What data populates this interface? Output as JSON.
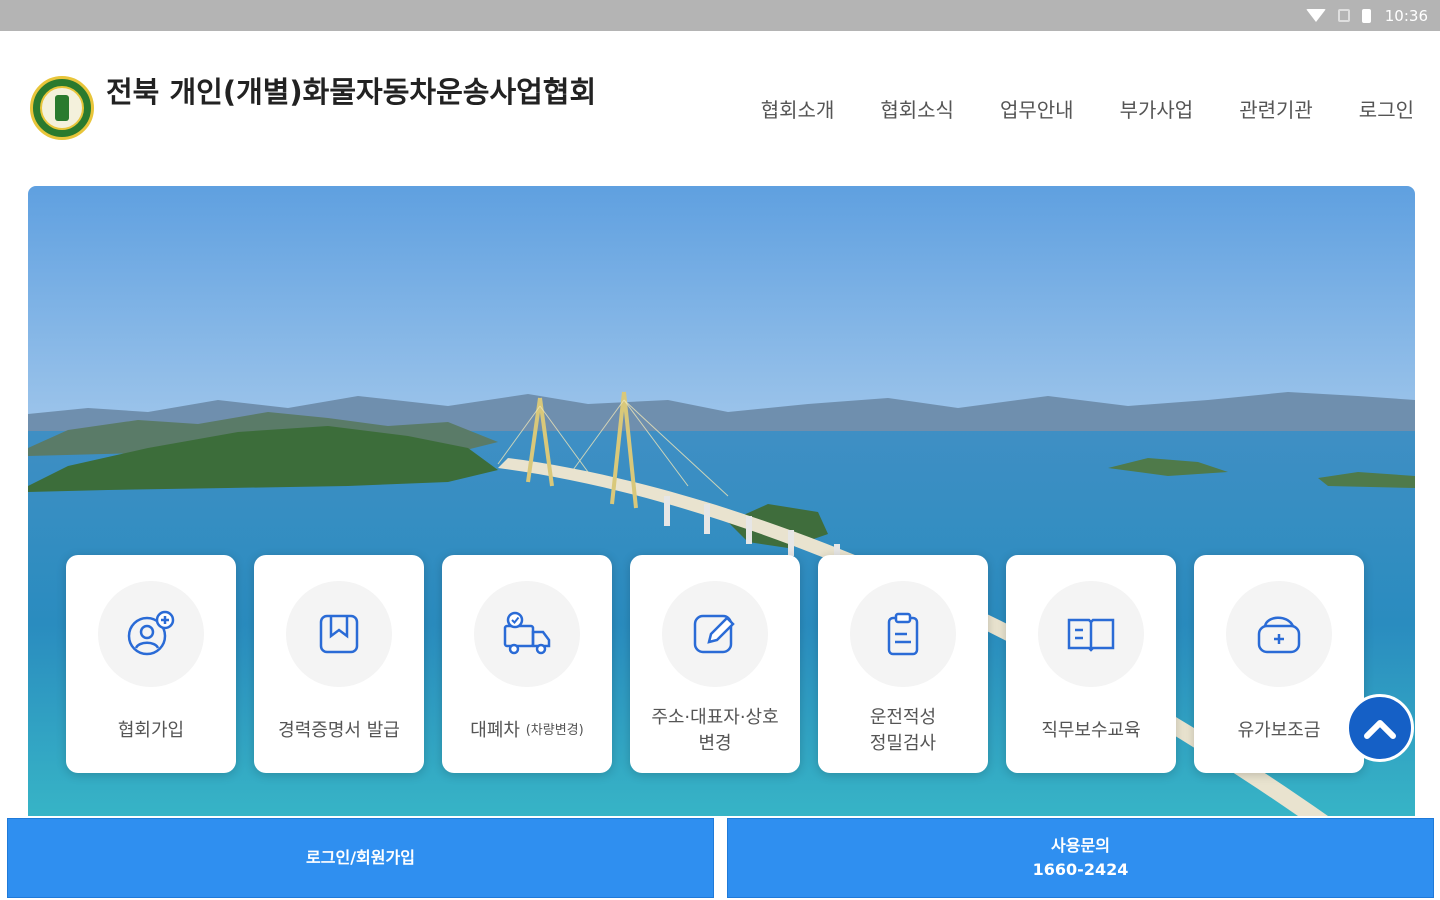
{
  "statusbar": {
    "time": "10:36"
  },
  "header": {
    "title": "전북 개인(개별)화물자동차운송사업협회",
    "nav": [
      "협회소개",
      "협회소식",
      "업무안내",
      "부가사업",
      "관련기관",
      "로그인"
    ]
  },
  "cards": [
    {
      "label": "협회가입",
      "icon": "user-add-icon"
    },
    {
      "label": "경력증명서 발급",
      "icon": "bookmark-icon"
    },
    {
      "label": "대폐차",
      "sub": "(차량변경)",
      "icon": "truck-icon"
    },
    {
      "label": "주소·대표자·상호\n변경",
      "icon": "edit-icon"
    },
    {
      "label": "운전적성\n정밀검사",
      "icon": "clipboard-icon"
    },
    {
      "label": "직무보수교육",
      "icon": "book-icon"
    },
    {
      "label": "유가보조금",
      "icon": "wallet-icon"
    }
  ],
  "buttons": {
    "login": "로그인/회원가입",
    "contact_label": "사용문의",
    "contact_phone": "1660-2424"
  },
  "colors": {
    "accent": "#2f8ff0",
    "scroll_top": "#1560c6",
    "icon_blue": "#2a6bd6"
  }
}
